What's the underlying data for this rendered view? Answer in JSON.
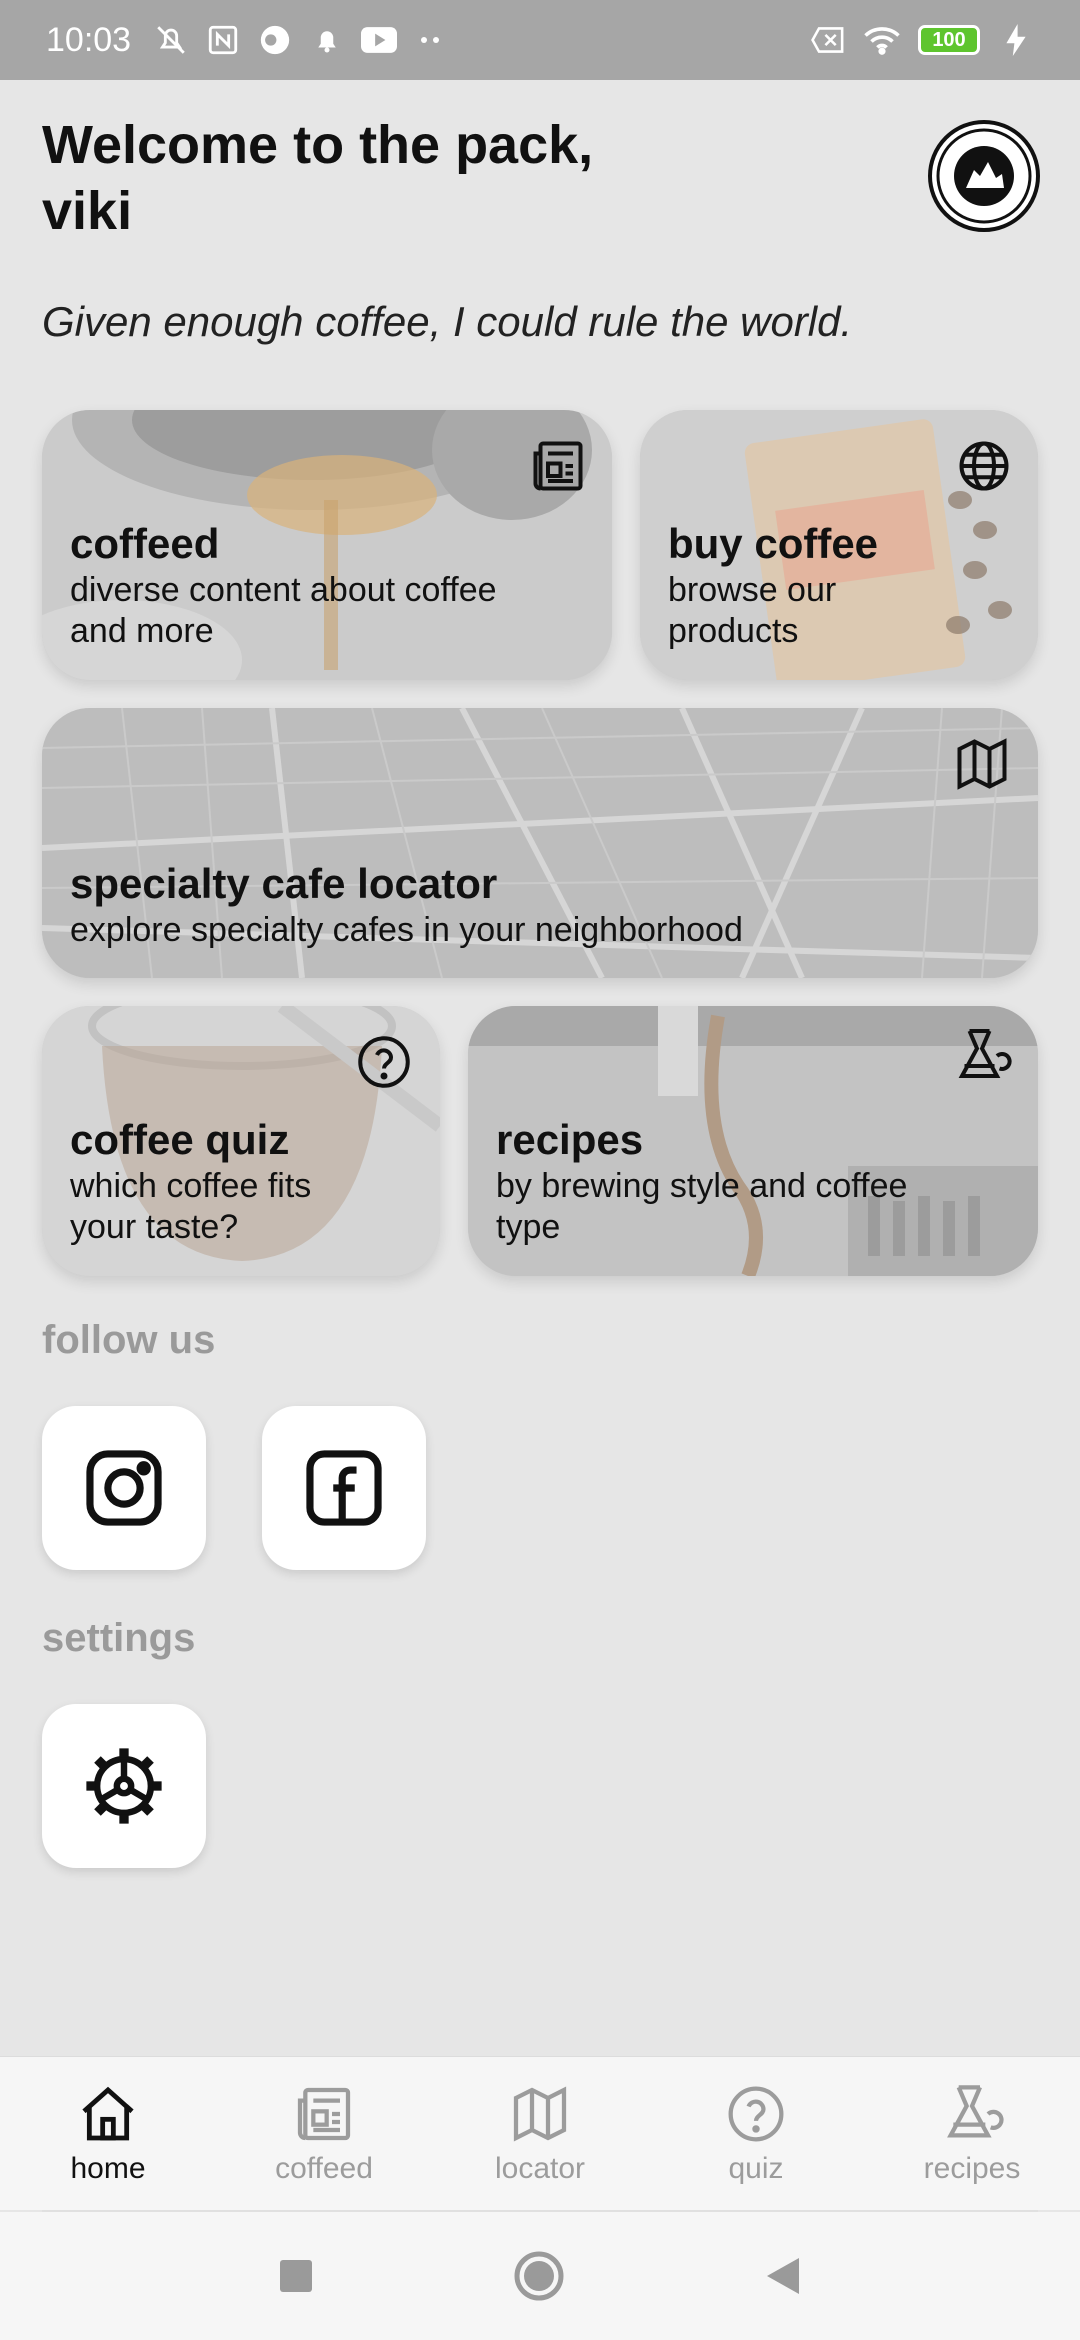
{
  "status_bar": {
    "time": "10:03",
    "battery": "100",
    "icons": [
      "mute-icon",
      "nfc-icon",
      "app-icon",
      "bell-icon",
      "youtube-icon",
      "more-dots-icon",
      "no-sim-icon",
      "wifi-icon",
      "battery-icon",
      "charging-icon"
    ]
  },
  "header": {
    "welcome_line1": "Welcome to the pack,",
    "welcome_line2": "viki",
    "logo_icon": "hoox-coffee-logo",
    "quote": "Given enough coffee, I could rule the world."
  },
  "cards": {
    "coffeed": {
      "title": "coffeed",
      "subtitle_line1": "diverse content about coffee",
      "subtitle_line2": "and more",
      "icon": "newspaper-icon"
    },
    "buy_coffee": {
      "title": "buy coffee",
      "subtitle_line1": "browse our",
      "subtitle_line2": "products",
      "icon": "globe-icon"
    },
    "locator": {
      "title": "specialty cafe locator",
      "subtitle_line1": "explore specialty cafes in your neighborhood",
      "icon": "map-icon"
    },
    "quiz": {
      "title": "coffee quiz",
      "subtitle_line1": "which coffee fits",
      "subtitle_line2": "your taste?",
      "icon": "question-icon"
    },
    "recipes": {
      "title": "recipes",
      "subtitle_line1": "by brewing style and coffee",
      "subtitle_line2": "type",
      "icon": "chemex-icon"
    }
  },
  "follow_us": {
    "title": "follow us",
    "buttons": [
      {
        "icon": "instagram-icon"
      },
      {
        "icon": "facebook-icon"
      }
    ]
  },
  "settings": {
    "title": "settings",
    "button_icon": "gear-icon"
  },
  "bottom_nav": {
    "items": [
      {
        "label": "home",
        "icon": "home-icon",
        "active": true
      },
      {
        "label": "coffeed",
        "icon": "newspaper-icon",
        "active": false
      },
      {
        "label": "locator",
        "icon": "map-icon",
        "active": false
      },
      {
        "label": "quiz",
        "icon": "question-icon",
        "active": false
      },
      {
        "label": "recipes",
        "icon": "chemex-icon",
        "active": false
      }
    ]
  },
  "colors": {
    "background": "#e6e6e6",
    "status_bar": "#a6a6a6",
    "section_title": "#9a9a9a",
    "battery": "#5ec52e"
  }
}
